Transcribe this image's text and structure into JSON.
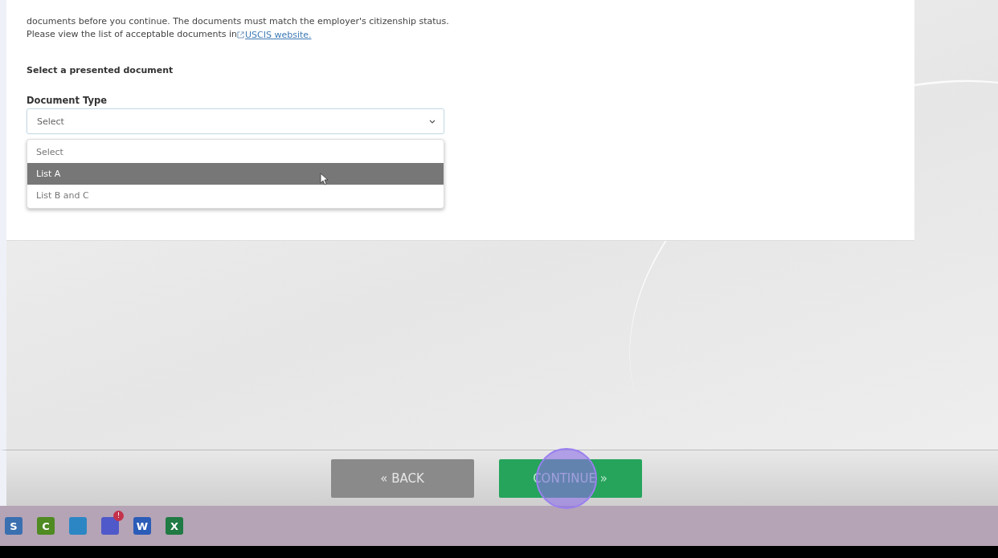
{
  "intro": {
    "line": "documents before you continue. The documents must match the employer's citizenship status.",
    "link_prefix": "Please view the list of acceptable documents in ",
    "link": "USCIS website."
  },
  "section_title": "Select a presented document",
  "document_type": {
    "label": "Document Type",
    "value": "Select",
    "expanded": true,
    "options": [
      {
        "label": "Select",
        "highlighted": false
      },
      {
        "label": "List A",
        "highlighted": true
      },
      {
        "label": "List B and C",
        "highlighted": false
      }
    ]
  },
  "buttons": [
    {
      "kind": "back",
      "label": "« BACK"
    },
    {
      "kind": "continue",
      "label": "CONTINUE »"
    }
  ],
  "taskbar": [
    {
      "kind": "s",
      "glyph": "S"
    },
    {
      "kind": "c",
      "glyph": "C"
    },
    {
      "kind": "share"
    },
    {
      "kind": "teams",
      "badge": "!"
    },
    {
      "kind": "word",
      "glyph": "W"
    },
    {
      "kind": "excel",
      "glyph": "X"
    }
  ]
}
